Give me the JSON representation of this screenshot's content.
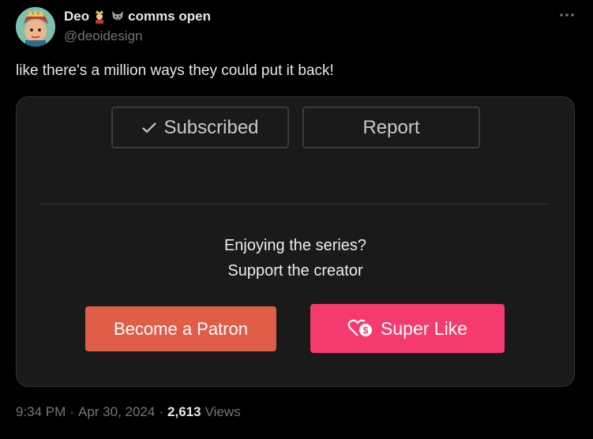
{
  "author": {
    "display_name_prefix": "Deo",
    "display_name_suffix": "comms open",
    "handle": "@deoidesign",
    "emojis": [
      "crowned-person-emoji",
      "wolf-emoji"
    ]
  },
  "tweet": {
    "text": "like there's a million ways they could put it back!"
  },
  "media": {
    "subscribed_label": "Subscribed",
    "report_label": "Report",
    "support_line1": "Enjoying the series?",
    "support_line2": "Support the creator",
    "patron_label": "Become a Patron",
    "superlike_label": "Super Like",
    "colors": {
      "patron": "#e05d48",
      "superlike": "#f53b6e"
    }
  },
  "footer": {
    "time": "9:34 PM",
    "dot1": "·",
    "date": "Apr 30, 2024",
    "dot2": "·",
    "views_count": "2,613",
    "views_label": "Views"
  }
}
